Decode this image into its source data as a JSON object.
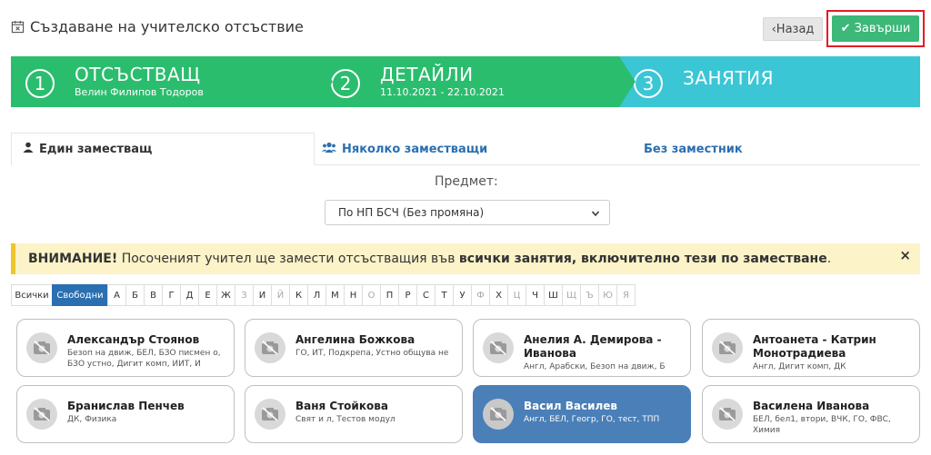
{
  "header": {
    "title": "Създаване на учителско отсъствие",
    "back_label": "Назад",
    "finish_label": "Завърши"
  },
  "wizard": [
    {
      "num": "1",
      "title": "ОТСЪСТВАЩ",
      "subtitle": "Велин Филипов Тодоров"
    },
    {
      "num": "2",
      "title": "ДЕТАЙЛИ",
      "subtitle": "11.10.2021 - 22.10.2021"
    },
    {
      "num": "3",
      "title": "ЗАНЯТИЯ",
      "subtitle": ""
    }
  ],
  "tabs": {
    "single": "Един заместващ",
    "multiple": "Няколко заместващи",
    "none": "Без заместник"
  },
  "subject": {
    "label": "Предмет:",
    "value": "По НП БСЧ (Без промяна)"
  },
  "alert": {
    "strong": "ВНИМАНИЕ!",
    "text1": " Посоченият учител ще замести отсъстващия във ",
    "strong2": "всички занятия, включително тези по заместване",
    "text2": ".",
    "close": "×"
  },
  "letters": {
    "all": "Всички",
    "free": "Свободни",
    "items": [
      "А",
      "Б",
      "В",
      "Г",
      "Д",
      "Е",
      "Ж",
      "З",
      "И",
      "Й",
      "К",
      "Л",
      "М",
      "Н",
      "О",
      "П",
      "Р",
      "С",
      "Т",
      "У",
      "Ф",
      "Х",
      "Ц",
      "Ч",
      "Ш",
      "Щ",
      "Ъ",
      "Ю",
      "Я"
    ],
    "disabled": [
      "З",
      "Й",
      "О",
      "Ф",
      "Ц",
      "Щ",
      "Ъ",
      "Ю",
      "Я"
    ]
  },
  "teachers": [
    {
      "name": "Александър Стоянов",
      "subjects": "Безоп на движ, БЕЛ, БЗО писмен о, БЗО устно, Дигит комп, ИИТ, И",
      "selected": false
    },
    {
      "name": "Ангелина Божкова",
      "subjects": "ГО, ИТ, Подкрепа, Устно общува не",
      "selected": false
    },
    {
      "name": "Анелия А. Демирова - Иванова",
      "subjects": "Англ, Арабски, Безоп на движ, Б",
      "selected": false
    },
    {
      "name": "Антоанета - Катрин Монотрадиева",
      "subjects": "Англ, Дигит комп, ДК",
      "selected": false
    },
    {
      "name": "Бранислав Пенчев",
      "subjects": "ДК, Физика",
      "selected": false
    },
    {
      "name": "Ваня Стойкова",
      "subjects": "Свят и л, Тестов модул",
      "selected": false
    },
    {
      "name": "Васил Василев",
      "subjects": "Англ, БЕЛ, Геогр, ГО, тест, ТПП",
      "selected": true
    },
    {
      "name": "Василена Иванова",
      "subjects": "БЕЛ, бел1, втори, ВЧК, ГО, ФВС, Химия",
      "selected": false
    }
  ],
  "colors": {
    "wizard_done": "#2bbd6e",
    "wizard_current": "#3bc6d6",
    "finish": "#3cb878",
    "link": "#2a6fb0",
    "selected_card": "#4a7fb8"
  }
}
